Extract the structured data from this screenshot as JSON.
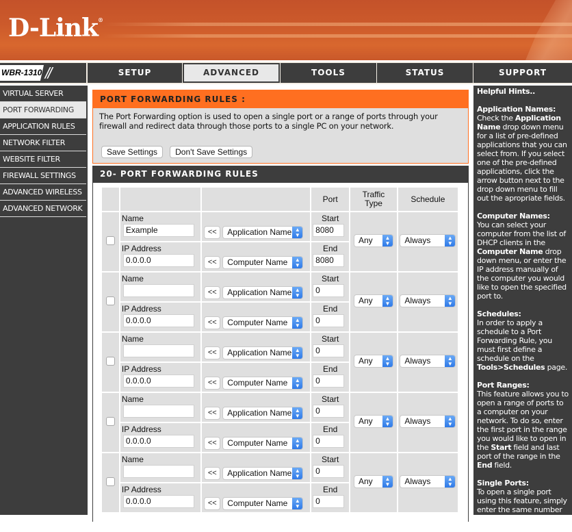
{
  "brand": {
    "logo": "D-Link",
    "registered_mark": "®",
    "model": "WBR-1310"
  },
  "topnav": {
    "tabs": [
      {
        "label": "SETUP",
        "active": false
      },
      {
        "label": "ADVANCED",
        "active": true
      },
      {
        "label": "TOOLS",
        "active": false
      },
      {
        "label": "STATUS",
        "active": false
      },
      {
        "label": "SUPPORT",
        "active": false
      }
    ]
  },
  "sidebar": {
    "items": [
      {
        "label": "VIRTUAL SERVER",
        "active": false
      },
      {
        "label": "PORT FORWARDING",
        "active": true
      },
      {
        "label": "APPLICATION RULES",
        "active": false
      },
      {
        "label": "NETWORK FILTER",
        "active": false
      },
      {
        "label": "WEBSITE FILTER",
        "active": false
      },
      {
        "label": "FIREWALL SETTINGS",
        "active": false
      },
      {
        "label": "ADVANCED WIRELESS",
        "active": false
      },
      {
        "label": "ADVANCED NETWORK",
        "active": false
      }
    ]
  },
  "intro": {
    "title": "PORT FORWARDING RULES :",
    "description": "The Port Forwarding option is used to open a single port or a range of ports through your firewall and redirect data through those ports to a single PC on your network.",
    "save_label": "Save Settings",
    "dont_save_label": "Don't Save Settings"
  },
  "rules": {
    "title": "20- PORT FORWARDING RULES",
    "headers": {
      "port": "Port",
      "traffic_type": "Traffic Type",
      "schedule": "Schedule"
    },
    "labels": {
      "name": "Name",
      "ip": "IP Address",
      "start": "Start",
      "end": "End",
      "arrow_button": "<<",
      "app_select": "Application Name",
      "computer_select": "Computer Name"
    },
    "rows": [
      {
        "checked": false,
        "name": "Example",
        "ip": "0.0.0.0",
        "start": "8080",
        "end": "8080",
        "traffic": "Any",
        "schedule": "Always"
      },
      {
        "checked": false,
        "name": "",
        "ip": "0.0.0.0",
        "start": "0",
        "end": "0",
        "traffic": "Any",
        "schedule": "Always"
      },
      {
        "checked": false,
        "name": "",
        "ip": "0.0.0.0",
        "start": "0",
        "end": "0",
        "traffic": "Any",
        "schedule": "Always"
      },
      {
        "checked": false,
        "name": "",
        "ip": "0.0.0.0",
        "start": "0",
        "end": "0",
        "traffic": "Any",
        "schedule": "Always"
      },
      {
        "checked": false,
        "name": "",
        "ip": "0.0.0.0",
        "start": "0",
        "end": "0",
        "traffic": "Any",
        "schedule": "Always"
      }
    ]
  },
  "hints": {
    "title": "Helpful Hints..",
    "sections": [
      {
        "heading": "Application Names:",
        "html": "Check the <b>Application Name</b> drop down menu for a list of pre-defined applications that you can select from. If you select one of the pre-defined applications, click the arrow button next to the drop down menu to fill out the apropriate fields."
      },
      {
        "heading": "Computer Names:",
        "html": "You can select your computer from the list of DHCP clients in the <b>Computer Name</b> drop down menu, or enter the IP address manually of the computer you would like to open the specified port to."
      },
      {
        "heading": "Schedules:",
        "html": "In order to apply a schedule to a Port Forwarding Rule, you must first define a schedule on the <b>Tools&gt;Schedules</b> page."
      },
      {
        "heading": "Port Ranges:",
        "html": "This feature allows you to open a range of ports to a computer on your network. To do so, enter the first port in the range you would like to open in the <b>Start</b> field and last port of the range in the <b>End</b> field."
      },
      {
        "heading": "Single Ports:",
        "html": "To open a single port using this feature, simply enter the same number in both the <b>Start</b> and <b>End</b> fields."
      }
    ]
  },
  "colors": {
    "accent": "#ff6f20",
    "dark": "#3d3d3d",
    "panel": "#dfdfdf",
    "banner": "#cc5a2b"
  }
}
